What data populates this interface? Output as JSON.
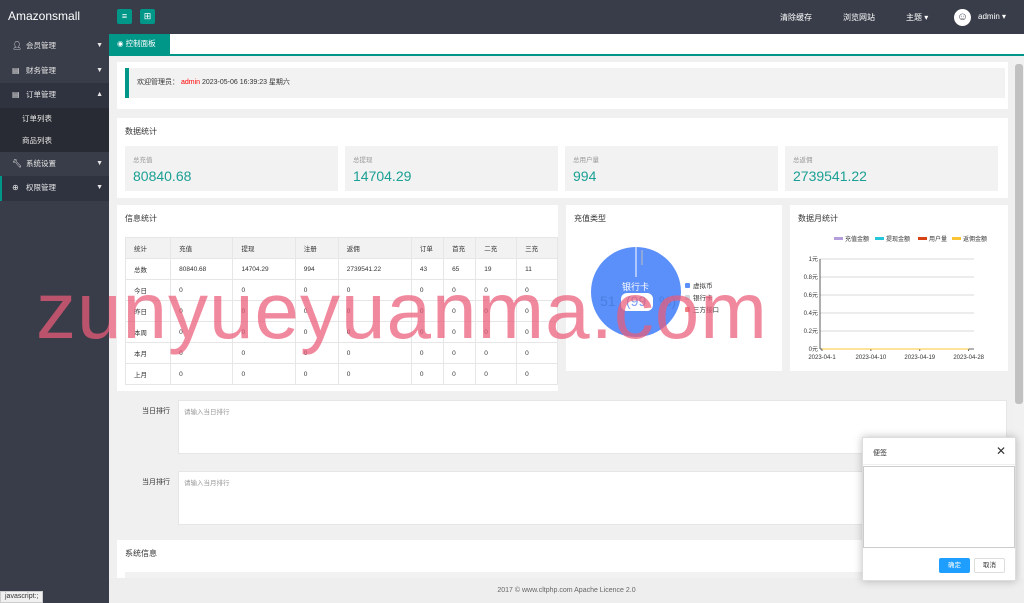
{
  "app": {
    "title": "Amazonsmall"
  },
  "topbar": {
    "menu_icon": "list-icon",
    "grid_icon": "grid-icon",
    "clear_cache": "清除缓存",
    "browse_site": "浏览网站",
    "theme": "主题",
    "user": "admin"
  },
  "sidebar": {
    "items": [
      {
        "label": "会员管理",
        "icon": "user-icon"
      },
      {
        "label": "财务管理",
        "icon": "database-icon"
      },
      {
        "label": "订单管理",
        "icon": "database-icon"
      },
      {
        "label": "系统设置",
        "icon": "wrench-icon"
      },
      {
        "label": "权限管理",
        "icon": "globe-icon"
      }
    ],
    "sub_items": [
      "订单列表",
      "商品列表"
    ]
  },
  "status_bar": "javascript:;",
  "tab": {
    "label": "控制面板",
    "icon": "globe-icon"
  },
  "welcome": {
    "prefix": "欢迎管理员：",
    "user": "admin",
    "datetime": "2023-05-06  16:39:23  星期六"
  },
  "stats": {
    "title": "数据统计",
    "cards": [
      {
        "label": "总充值",
        "value": "80840.68"
      },
      {
        "label": "总提现",
        "value": "14704.29"
      },
      {
        "label": "总用户量",
        "value": "994"
      },
      {
        "label": "总返佣",
        "value": "2739541.22"
      }
    ]
  },
  "info": {
    "title": "信息统计",
    "headers": [
      "统计",
      "充值",
      "提现",
      "注册",
      "返佣",
      "订单",
      "首充",
      "二充",
      "三充"
    ],
    "rows": [
      [
        "总数",
        "80840.68",
        "14704.29",
        "994",
        "2739541.22",
        "43",
        "65",
        "19",
        "11"
      ],
      [
        "今日",
        "0",
        "0",
        "0",
        "0",
        "0",
        "0",
        "0",
        "0"
      ],
      [
        "昨日",
        "0",
        "0",
        "0",
        "0",
        "0",
        "0",
        "0",
        "0"
      ],
      [
        "本周",
        "0",
        "0",
        "0",
        "0",
        "0",
        "0",
        "0",
        "0"
      ],
      [
        "本月",
        "0",
        "0",
        "0",
        "0",
        "0",
        "0",
        "0",
        "0"
      ],
      [
        "上月",
        "0",
        "0",
        "0",
        "0",
        "0",
        "0",
        "0",
        "0"
      ]
    ]
  },
  "recharge_type": {
    "title": "充值类型",
    "center_label": "银行卡",
    "center_value": "(99",
    "left_fragment": "51",
    "right_fragment": "%)",
    "legend": [
      "虚拟币",
      "银行卡",
      "三方接口"
    ],
    "colors": {
      "main": "#5b8ff9",
      "legend1": "#5b8ff9",
      "legend2": "#cfd8dc",
      "legend3": "#f08080"
    }
  },
  "monthly": {
    "title": "数据月统计",
    "legend_colors": [
      "#b39ddb",
      "#26c6da",
      "#d84315",
      "#f9c534"
    ]
  },
  "chart_data": {
    "type": "line",
    "title": "数据月统计",
    "categories": [
      "2023-04-1",
      "2023-04-10",
      "2023-04-19",
      "2023-04-28"
    ],
    "tick_labels": [
      "0元",
      "0.2元",
      "0.4元",
      "0.6元",
      "0.8元",
      "1元"
    ],
    "ylim": [
      0,
      1
    ],
    "series": [
      {
        "name": "充值金额",
        "values": [
          0,
          0,
          0,
          0
        ]
      },
      {
        "name": "提现金额",
        "values": [
          0,
          0,
          0,
          0
        ]
      },
      {
        "name": "用户量",
        "values": [
          0,
          0,
          0,
          0
        ]
      },
      {
        "name": "返佣金额",
        "values": [
          0,
          0,
          0,
          0
        ]
      }
    ]
  },
  "ranking": {
    "today_label": "当日排行",
    "today_placeholder": "请输入当日排行",
    "month_label": "当月排行",
    "month_placeholder": "请输入当月排行"
  },
  "system_info": {
    "title": "系统信息"
  },
  "footer": {
    "text": "2017 ©  www.cltphp.com  Apache Licence 2.0"
  },
  "modal": {
    "title": "便签",
    "ok": "确定",
    "cancel": "取消"
  },
  "watermark": "zunyueyuanma.com"
}
